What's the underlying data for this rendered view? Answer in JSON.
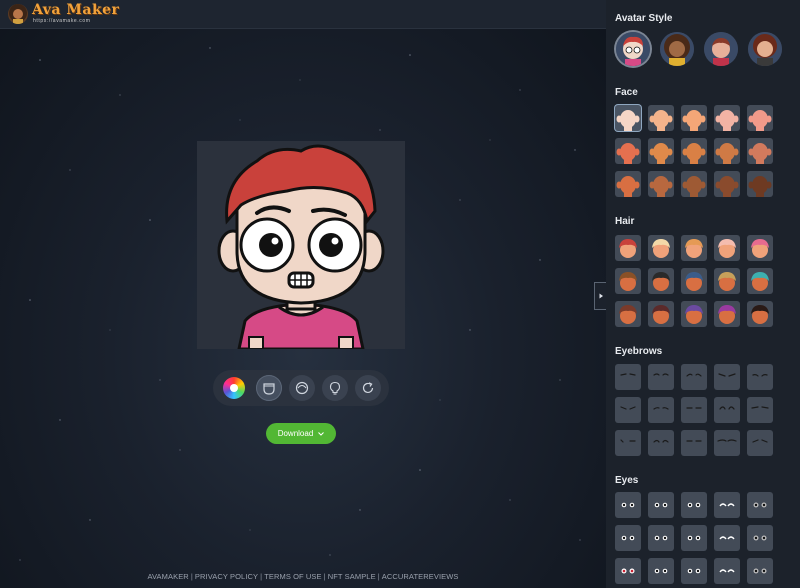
{
  "app": {
    "title": "Ava Maker",
    "url": "https://avamake.com"
  },
  "toolbar": {
    "tools": [
      {
        "name": "color-picker-icon"
      },
      {
        "name": "face-shape-icon"
      },
      {
        "name": "head-icon"
      },
      {
        "name": "idea-bulb-icon"
      },
      {
        "name": "refresh-icon"
      }
    ]
  },
  "download": {
    "label": "Download",
    "icon": "chevron-down-icon"
  },
  "footer": {
    "links": [
      "AVAMAKER",
      "PRIVACY POLICY",
      "TERMS OF USE",
      "NFT SAMPLE",
      "ACCURATEREVIEWS"
    ]
  },
  "panel": {
    "avatar_style": {
      "title": "Avatar Style"
    },
    "face": {
      "title": "Face"
    },
    "hair": {
      "title": "Hair"
    },
    "eyebrows": {
      "title": "Eyebrows"
    },
    "eyes": {
      "title": "Eyes"
    }
  },
  "colors": {
    "accent_green": "#52b734",
    "logo_orange": "#f2a23a",
    "panel_bg": "#1c222b"
  },
  "skin_tones": [
    "#f6d6c6",
    "#f5b48b",
    "#f4a677",
    "#f2b3a4",
    "#f19a8a",
    "#e5704f",
    "#e08a4a",
    "#d98045",
    "#cf7a45",
    "#d27a5d",
    "#d86f42",
    "#b8683f",
    "#9e5a34",
    "#8a4b2d",
    "#6e3a22"
  ],
  "hair_colors": [
    "#c9413b",
    "#f3d9a8",
    "#e59a55",
    "#f4bcae",
    "#e76b8f",
    "#8a5127",
    "#2a2a2a",
    "#3a5c8a",
    "#c7a05a",
    "#3db0b0",
    "#7a3a2a",
    "#5b2a2a",
    "#6b4aa0",
    "#9a3aa0",
    "#2a1a16"
  ]
}
